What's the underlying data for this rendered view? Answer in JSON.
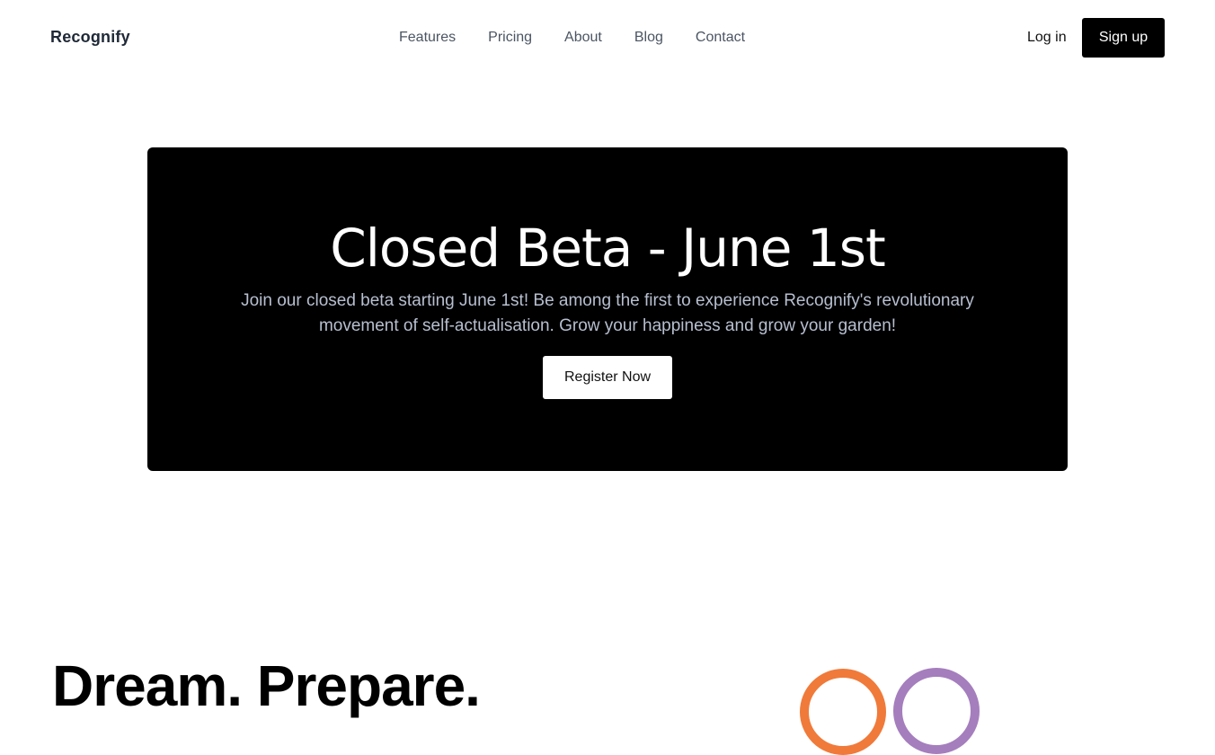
{
  "header": {
    "brand": "Recognify",
    "nav": [
      "Features",
      "Pricing",
      "About",
      "Blog",
      "Contact"
    ],
    "login_label": "Log in",
    "signup_label": "Sign up"
  },
  "hero": {
    "title": "Closed Beta - June 1st",
    "description": "Join our closed beta starting June 1st! Be among the first to experience Recognify's revolutionary movement of self-actualisation. Grow your happiness and grow your garden!",
    "cta_label": "Register Now"
  },
  "section": {
    "heading": "Dream. Prepare."
  },
  "colors": {
    "accent_orange": "#f07a3a",
    "accent_purple": "#a57ebd",
    "hero_bg": "#000000",
    "hero_text_muted": "#b7bfd0"
  }
}
